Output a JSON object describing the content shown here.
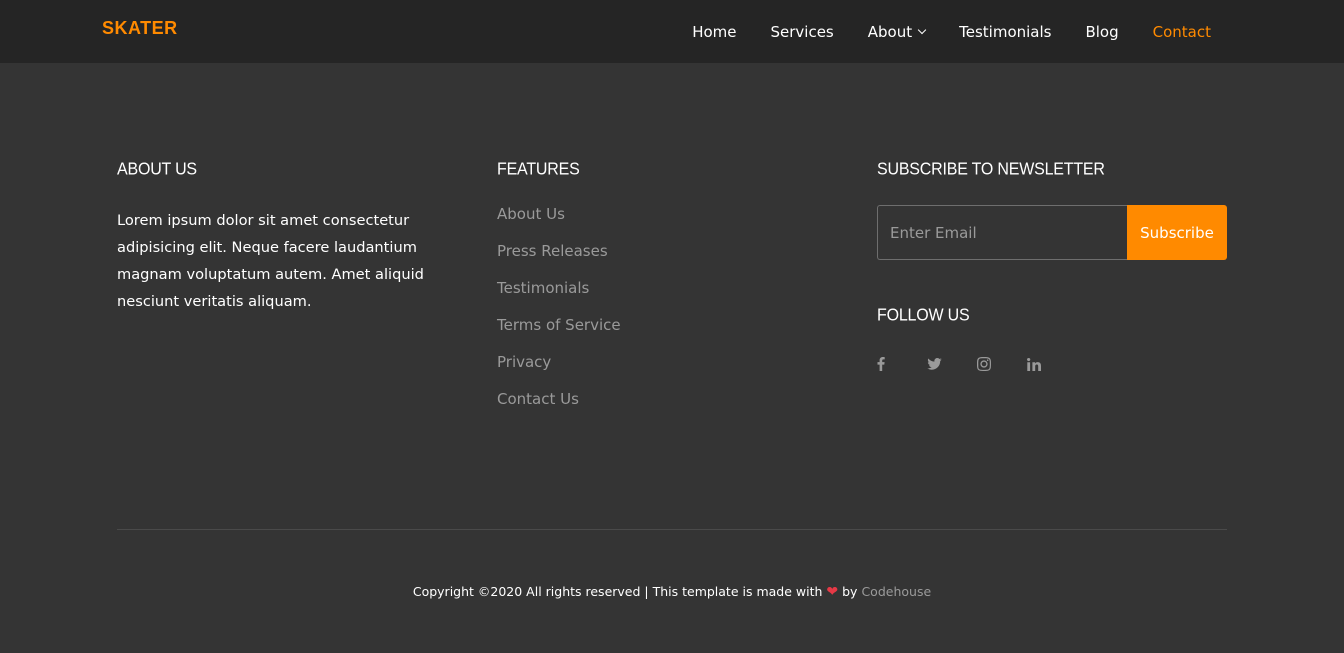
{
  "header": {
    "logo": "SKATER",
    "nav": [
      {
        "label": "Home"
      },
      {
        "label": "Services"
      },
      {
        "label": "About"
      },
      {
        "label": "Testimonials"
      },
      {
        "label": "Blog"
      },
      {
        "label": "Contact"
      }
    ]
  },
  "footer": {
    "about": {
      "title": "ABOUT US",
      "text": "Lorem ipsum dolor sit amet consectetur adipisicing elit. Neque facere laudantium magnam voluptatum autem. Amet aliquid nesciunt veritatis aliquam."
    },
    "features": {
      "title": "FEATURES",
      "links": [
        "About Us",
        "Press Releases",
        "Testimonials",
        "Terms of Service",
        "Privacy",
        "Contact Us"
      ]
    },
    "newsletter": {
      "title": "SUBSCRIBE TO NEWSLETTER",
      "email_placeholder": "Enter Email",
      "button": "Subscribe"
    },
    "follow": {
      "title": "FOLLOW US",
      "icons": [
        "facebook-icon",
        "twitter-icon",
        "instagram-icon",
        "linkedin-icon"
      ]
    },
    "copyright": {
      "text": "Copyright ©2020 All rights reserved | This template is made with",
      "by": "by",
      "credit": "Codehouse"
    }
  },
  "colors": {
    "accent": "#ff8a00",
    "background": "#343434",
    "header": "#252525",
    "muted": "#9a9a9a",
    "heart": "#e63946"
  }
}
